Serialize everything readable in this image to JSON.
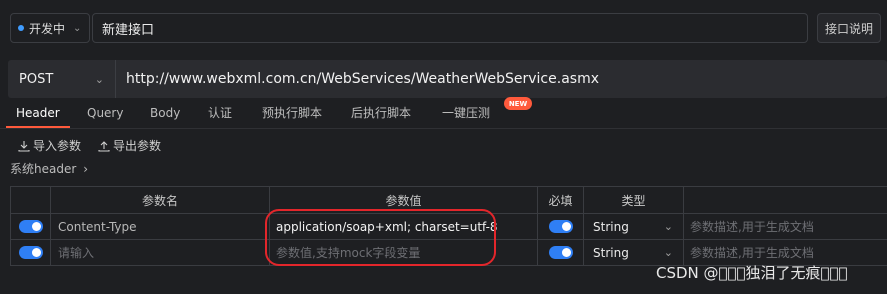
{
  "top": {
    "status": "开发中",
    "api_name": "新建接口",
    "doc_button": "接口说明"
  },
  "request": {
    "method": "POST",
    "url": "http://www.webxml.com.cn/WebServices/WeatherWebService.asmx"
  },
  "tabs": [
    {
      "label": "Header",
      "active": true
    },
    {
      "label": "Query"
    },
    {
      "label": "Body"
    },
    {
      "label": "认证"
    },
    {
      "label": "预执行脚本"
    },
    {
      "label": "后执行脚本"
    },
    {
      "label": "一键压测"
    }
  ],
  "new_badge": "NEW",
  "tools": {
    "import": "导入参数",
    "export": "导出参数",
    "system_header": "系统header"
  },
  "table": {
    "headers": {
      "name": "参数名",
      "value": "参数值",
      "required": "必填",
      "type": "类型"
    },
    "rows": [
      {
        "enabled": true,
        "name": "Content-Type",
        "value": "application/soap+xml; charset=utf-8",
        "required": true,
        "type": "String",
        "description_placeholder": "参数描述,用于生成文档"
      },
      {
        "enabled": true,
        "name_placeholder": "请输入",
        "value_placeholder": "参数值,支持mock字段变量",
        "required": true,
        "type": "String",
        "description_placeholder": "参数描述,用于生成文档"
      }
    ]
  },
  "watermark": "CSDN @\u0000\u0000\u0000独泪了无痕\u0000\u0000\u0000",
  "colors": {
    "accent": "#ff5a3c",
    "toggle": "#2f7ff5",
    "highlight_ring": "#e3262b",
    "status_dot": "#3f9cff"
  }
}
